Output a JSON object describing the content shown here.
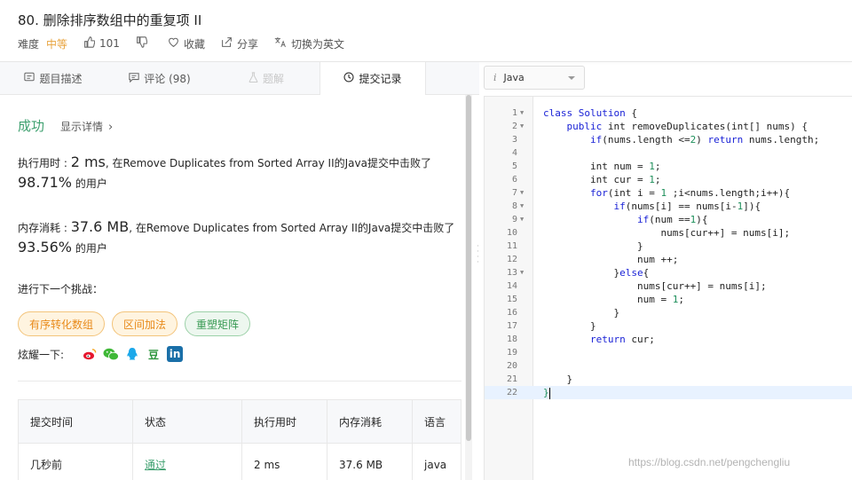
{
  "header": {
    "title": "80. 删除排序数组中的重复项 II",
    "difficulty_label": "难度",
    "difficulty_value": "中等",
    "likes": "101",
    "favorite": "收藏",
    "share": "分享",
    "switch_lang": "切换为英文"
  },
  "tabs": [
    {
      "label": "题目描述"
    },
    {
      "label": "评论 (98)"
    },
    {
      "label": "题解"
    },
    {
      "label": "提交记录"
    }
  ],
  "result": {
    "status": "成功",
    "detail": "显示详情",
    "runtime_prefix": "执行用时 : ",
    "runtime_value": "2 ms",
    "runtime_mid": ", 在Remove Duplicates from Sorted Array II的Java提交中击败了",
    "runtime_percent": "98.71%",
    "runtime_suffix": " 的用户",
    "memory_prefix": "内存消耗 : ",
    "memory_value": "37.6 MB",
    "memory_mid": ", 在Remove Duplicates from Sorted Array II的Java提交中击败了",
    "memory_percent": "93.56%",
    "memory_suffix": " 的用户"
  },
  "challenge": {
    "title": "进行下一个挑战：",
    "tags": [
      "有序转化数组",
      "区间加法",
      "重塑矩阵"
    ]
  },
  "share_row": {
    "label": "炫耀一下:",
    "douban": "豆",
    "linkedin": "in"
  },
  "table": {
    "headers": [
      "提交时间",
      "状态",
      "执行用时",
      "内存消耗",
      "语言"
    ],
    "row": [
      "几秒前",
      "通过",
      "2 ms",
      "37.6 MB",
      "java"
    ]
  },
  "editor": {
    "language": "Java",
    "lang_icon": "i"
  },
  "watermark": "https://blog.csdn.net/pengchengliu"
}
